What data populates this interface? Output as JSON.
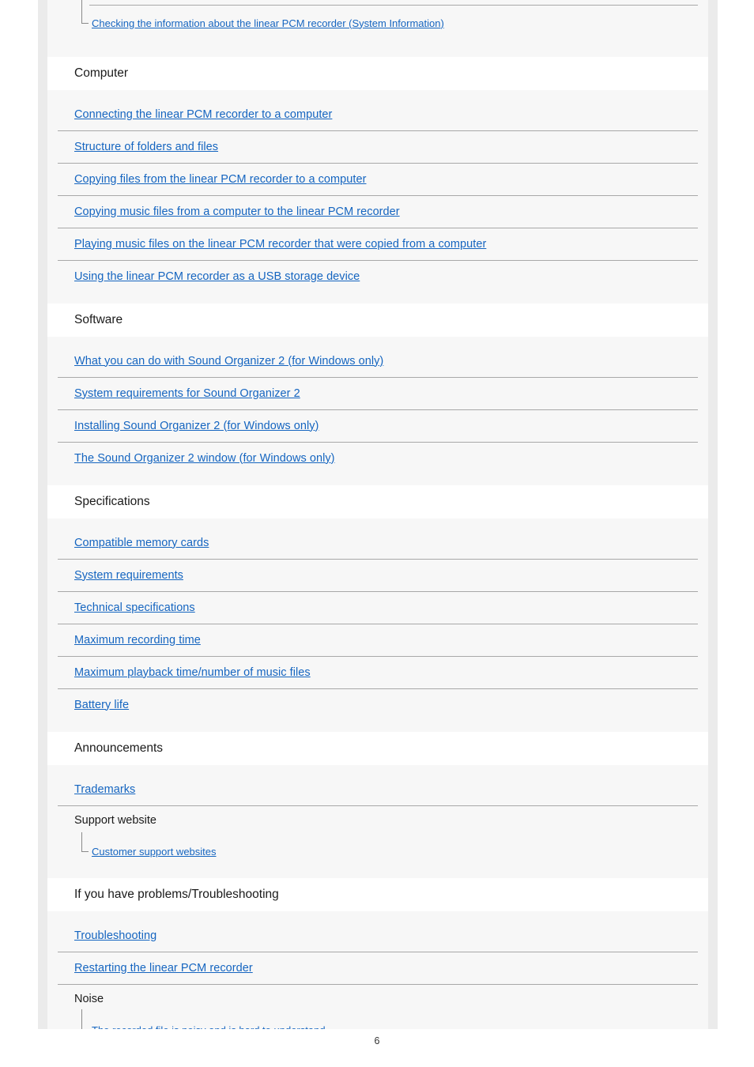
{
  "document": {
    "page_number": "6",
    "link_color": "#1565c0",
    "rule_color": "#a8a8a8",
    "card_background": "#f7f7f7",
    "frame_background": "#ebebeb"
  },
  "top_partial_entry": {
    "label": "Checking the information about the linear PCM recorder (System Information)",
    "connector": "last"
  },
  "sections": [
    {
      "title": "Computer",
      "entries": [
        {
          "label": "Connecting the linear PCM recorder to a computer"
        },
        {
          "label": "Structure of folders and files"
        },
        {
          "label": "Copying files from the linear PCM recorder to a computer"
        },
        {
          "label": "Copying music files from a computer to the linear PCM recorder"
        },
        {
          "label": "Playing music files on the linear PCM recorder that were copied from a computer"
        },
        {
          "label": "Using the linear PCM recorder as a USB storage device"
        }
      ]
    },
    {
      "title": "Software",
      "entries": [
        {
          "label": "What you can do with Sound Organizer 2 (for Windows only)"
        },
        {
          "label": "System requirements for Sound Organizer 2"
        },
        {
          "label": "Installing Sound Organizer 2 (for Windows only)"
        },
        {
          "label": "The Sound Organizer 2 window (for Windows only)"
        }
      ]
    },
    {
      "title": "Specifications",
      "entries": [
        {
          "label": "Compatible memory cards"
        },
        {
          "label": "System requirements"
        },
        {
          "label": "Technical specifications"
        },
        {
          "label": "Maximum recording time"
        },
        {
          "label": "Maximum playback time/number of music files"
        },
        {
          "label": "Battery life"
        }
      ]
    },
    {
      "title": "Announcements",
      "entries": [
        {
          "label": "Trademarks"
        }
      ],
      "subgroups": [
        {
          "label": "Support website",
          "children": [
            {
              "label": "Customer support websites",
              "connector": "last"
            }
          ]
        }
      ]
    },
    {
      "title": "If you have problems/Troubleshooting",
      "entries": [
        {
          "label": "Troubleshooting"
        },
        {
          "label": "Restarting the linear PCM recorder"
        }
      ],
      "subgroups": [
        {
          "label": "Noise",
          "children": [
            {
              "label": "The recorded file is noisy and is hard to understand.",
              "connector": "middle"
            }
          ]
        }
      ]
    }
  ]
}
